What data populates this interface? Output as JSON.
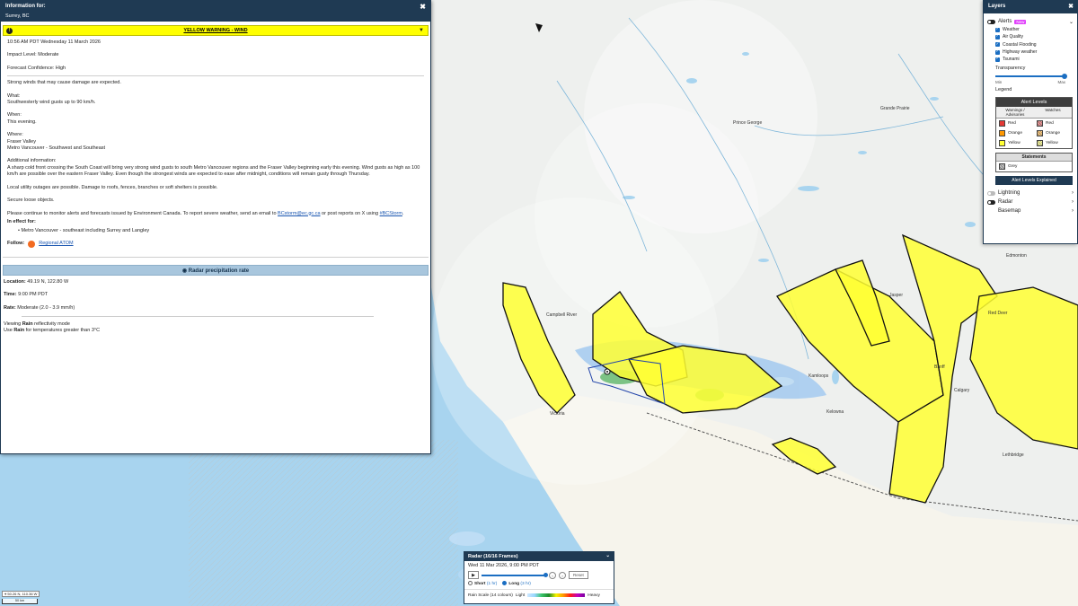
{
  "info_panel": {
    "title": "Information for:",
    "location": "Surrey, BC",
    "close_glyph": "✖",
    "warning": {
      "icon": "!",
      "title": "YELLOW WARNING - WIND",
      "chevron": "▼",
      "color": "#ffff00"
    },
    "issued": "10:56 AM PDT Wednesday 11 March 2026",
    "impact": "Impact Level: Moderate",
    "confidence": "Forecast Confidence: High",
    "summary": "Strong winds that may cause damage are expected.",
    "what_label": "What:",
    "what_text": "Southwesterly wind gusts up to 90 km/h.",
    "when_label": "When:",
    "when_text": "This evening.",
    "where_label": "Where:",
    "where_line1": "Fraser Valley",
    "where_line2": "Metro Vancouver - Southwest and Southeast",
    "additional_label": "Additional information:",
    "additional_text": "A sharp cold front crossing the South Coast will bring very strong wind gusts to south Metro Vancouver regions and the Fraser Valley beginning early this evening. Wind gusts as high as 100 km/h are possible over the eastern Fraser Valley. Even though the strongest winds are expected to ease after midnight, conditions will remain gusty through Thursday.",
    "local_text": "Local utility outages are possible. Damage to roofs, fences, branches or soft shelters is possible.",
    "secure_text": "Secure loose objects.",
    "monitor_pre": "Please continue to monitor alerts and forecasts issued by Environment Canada. To report severe weather, send an email to ",
    "monitor_email": "BCstorm@ec.gc.ca",
    "monitor_mid": " or post reports on X using ",
    "monitor_tag": "#BCStorm",
    "monitor_end": ".",
    "in_effect_label": "In effect for:",
    "in_effect_item": "Metro Vancouver - southeast including Surrey and Langley",
    "follow_label": "Follow:",
    "follow_link": "Regional ATOM"
  },
  "radar_info": {
    "title": "Radar precipitation rate",
    "location_label": "Location:",
    "location_value": "49.19 N, 122.80 W",
    "time_label": "Time:",
    "time_value": "9:00 PM PDT",
    "rate_label": "Rate:",
    "rate_value": "Moderate (2.0 - 3.9 mm/h)",
    "viewing_pre": "Viewing ",
    "viewing_mode": "Rain",
    "viewing_post": " reflectivity mode",
    "use_pre": "Use ",
    "use_mode": "Rain",
    "use_post": " for temperatures greater than 3°C"
  },
  "layers": {
    "title": "Layers",
    "close_glyph": "✖",
    "alerts_label": "Alerts",
    "alerts_badge": "New",
    "alert_types": [
      "Weather",
      "Air Quality",
      "Coastal Flooding",
      "Highway weather",
      "Tsunami"
    ],
    "transparency_label": "Transparency",
    "transparency_level": 1.0,
    "min_label": "Min",
    "max_label": "Max",
    "legend_label": "Legend",
    "alert_levels_title": "Alert Levels",
    "col_warnings": "Warnings / Advisories",
    "col_watches": "Watches",
    "levels": [
      {
        "name": "Red",
        "color": "#e53935"
      },
      {
        "name": "Orange",
        "color": "#ff9800"
      },
      {
        "name": "Yellow",
        "color": "#ffff33"
      }
    ],
    "watches": [
      {
        "name": "Red",
        "color": "#f4a0a0"
      },
      {
        "name": "Orange",
        "color": "#ffd089"
      },
      {
        "name": "Yellow",
        "color": "#ffffa6"
      }
    ],
    "statements_title": "Statements",
    "statements_item": "Grey",
    "explained_button": "Alert Levels Explained",
    "lightning_label": "Lightning",
    "radar_label": "Radar",
    "basemap_label": "Basemap"
  },
  "player": {
    "title": "Radar (16/16 Frames)",
    "datetime": "Wed 11 Mar 2026, 9:00 PM PDT",
    "play_glyph": "▶",
    "progress": 1.0,
    "reset_label": "Reset",
    "short_label": "Short",
    "short_range": "(1 hr)",
    "long_label": "Long",
    "long_range": "(3 hr)",
    "scale_label": "Rain Scale (14 colours)",
    "light_label": "Light",
    "heavy_label": "Heavy"
  },
  "map_labels": {
    "prince_george": "Prince George",
    "grande_prairie": "Grande Prairie",
    "edmonton": "Edmonton",
    "campbell_river": "Campbell River",
    "victoria": "Victoria",
    "calgary": "Calgary",
    "kamloops": "Kamloops",
    "kelowna": "Kelowna",
    "lethbridge": "Lethbridge",
    "red_deer": "Red Deer",
    "jasper": "Jasper",
    "banff": "Banff"
  },
  "coords_readout": "50.26 N, 110.36 W",
  "scale_text": "50 km"
}
